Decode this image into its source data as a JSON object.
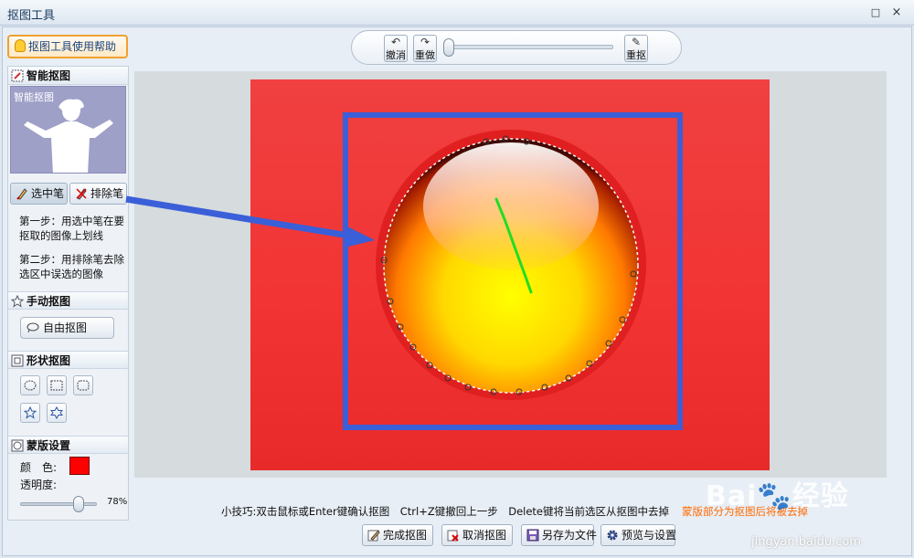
{
  "window": {
    "title": "抠图工具",
    "maximize_glyph": "□",
    "close_glyph": "×"
  },
  "help_button": {
    "label": "抠图工具使用帮助",
    "icon": "lightbulb-icon"
  },
  "smart_cutout": {
    "heading": "智能抠图",
    "thumbnail_label": "智能抠图",
    "select_pen_label": "选中笔",
    "exclude_pen_label": "排除笔",
    "step1": "第一步：用选中笔在要抠取的图像上划线",
    "step2": "第二步：用排除笔去除选区中误选的图像"
  },
  "manual_cutout": {
    "heading": "手动抠图",
    "free_cutout_label": "自由抠图"
  },
  "shape_cutout": {
    "heading": "形状抠图",
    "shapes": [
      "ellipse-select-icon",
      "rectangle-select-icon",
      "rounded-rectangle-select-icon",
      "star5-select-icon",
      "star6-select-icon"
    ]
  },
  "mask_settings": {
    "heading": "蒙版设置",
    "color_label": "颜　色:",
    "color_value": "#ff0000",
    "opacity_label": "透明度:",
    "opacity_value": "78%",
    "opacity_level": 0.78
  },
  "toolbar": {
    "undo_label": "撤消",
    "redo_label": "重做",
    "redraw_label": "重抠",
    "undo_glyph": "↶",
    "redo_glyph": "↷",
    "redraw_glyph": "✎"
  },
  "bottom": {
    "tip": "小技巧:双击鼠标或Enter键确认抠图　Ctrl+Z键撤回上一步　Delete键将当前选区从抠图中去掉",
    "tip_orange": "蒙版部分为抠图后将被去掉",
    "finish_label": "完成抠图",
    "cancel_label": "取消抠图",
    "save_label": "另存为文件",
    "preview_label": "预览与设置"
  },
  "watermark": {
    "main": "Bai🐾经验",
    "sub": "jingyan.baidu.com"
  }
}
